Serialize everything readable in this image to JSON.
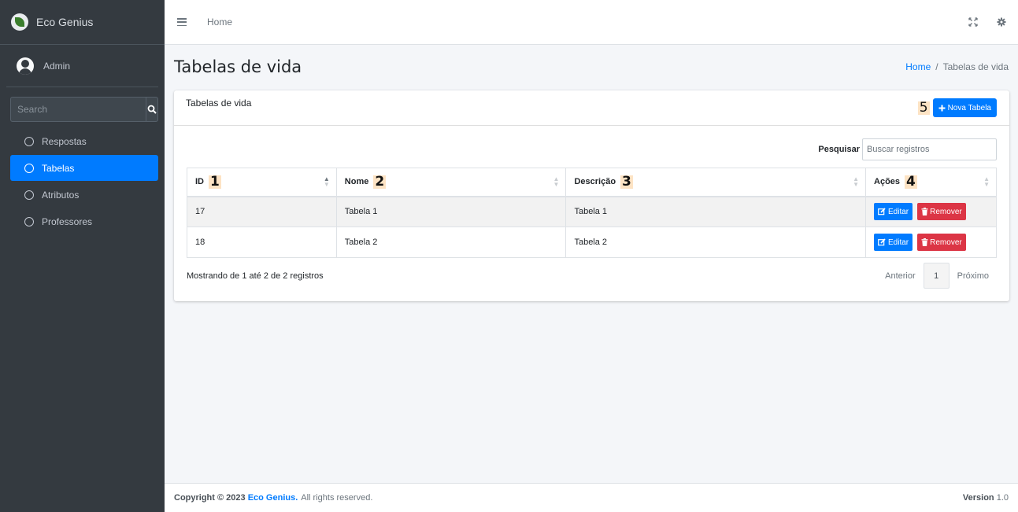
{
  "sidebar": {
    "brand": "Eco Genius",
    "user": "Admin",
    "search_placeholder": "Search",
    "items": [
      {
        "label": "Respostas"
      },
      {
        "label": "Tabelas"
      },
      {
        "label": "Atributos"
      },
      {
        "label": "Professores"
      }
    ]
  },
  "topbar": {
    "home": "Home"
  },
  "header": {
    "title": "Tabelas de vida",
    "breadcrumb_home": "Home",
    "breadcrumb_sep": "/",
    "breadcrumb_current": "Tabelas de vida"
  },
  "card": {
    "title": "Tabelas de vida",
    "new_button": "Nova Tabela",
    "new_button_marker": "5",
    "search_label": "Pesquisar",
    "search_placeholder": "Buscar registros",
    "columns": [
      {
        "label": "ID",
        "marker": "1"
      },
      {
        "label": "Nome",
        "marker": "2"
      },
      {
        "label": "Descrição",
        "marker": "3"
      },
      {
        "label": "Ações",
        "marker": "4"
      }
    ],
    "rows": [
      {
        "id": "17",
        "nome": "Tabela 1",
        "descricao": "Tabela 1"
      },
      {
        "id": "18",
        "nome": "Tabela 2",
        "descricao": "Tabela 2"
      }
    ],
    "edit_label": "Editar",
    "remove_label": "Remover",
    "info": "Mostrando de 1 até 2 de 2 registros",
    "prev": "Anterior",
    "page": "1",
    "next": "Próximo"
  },
  "footer": {
    "copyright": "Copyright © 2023",
    "brand": "Eco Genius.",
    "rights": "All rights reserved.",
    "version_label": "Version",
    "version": "1.0"
  },
  "colors": {
    "primary": "#007bff",
    "danger": "#dc3545",
    "sidebar_bg": "#343a40"
  }
}
